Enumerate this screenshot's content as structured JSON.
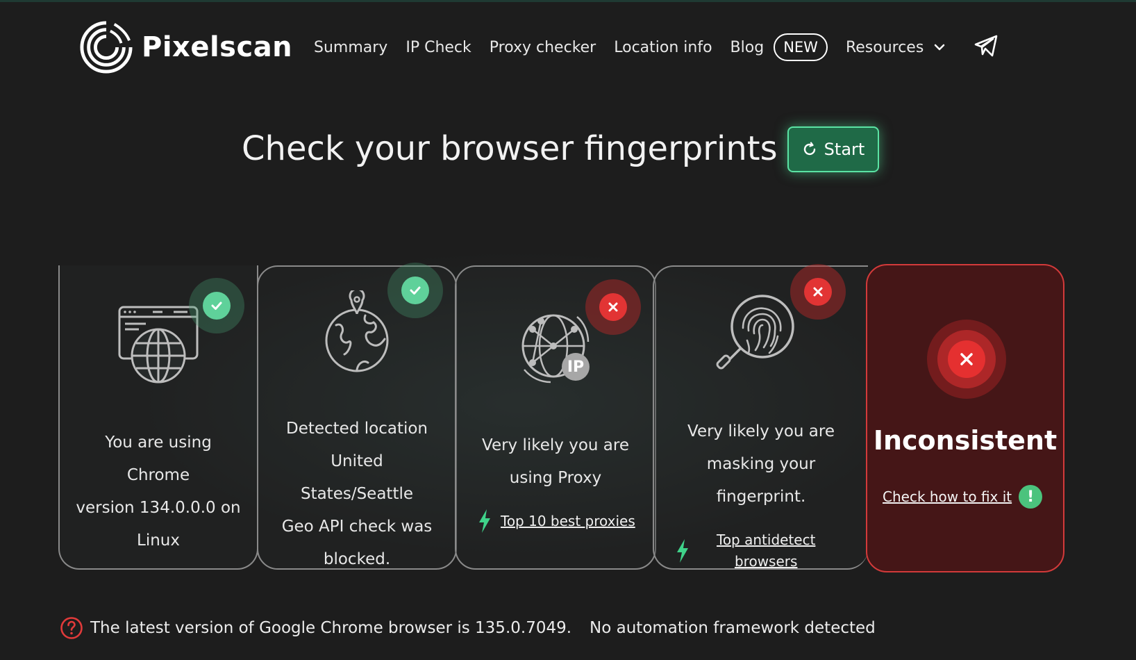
{
  "brand": {
    "name": "Pixelscan"
  },
  "nav": {
    "items": [
      {
        "label": "Summary"
      },
      {
        "label": "IP Check"
      },
      {
        "label": "Proxy checker"
      },
      {
        "label": "Location info"
      },
      {
        "label": "Blog"
      }
    ],
    "new_badge": "NEW",
    "resources_label": "Resources"
  },
  "hero": {
    "title": "Check your browser fingerprints",
    "start_label": "Start"
  },
  "cards": [
    {
      "status": "ok",
      "icon": "browser-globe-icon",
      "lines": [
        "You are using",
        "Chrome",
        "version 134.0.0.0 on",
        "Linux"
      ]
    },
    {
      "status": "ok",
      "icon": "earth-location-icon",
      "lines": [
        "Detected location",
        "United",
        "States/Seattle",
        "Geo API check was",
        "blocked."
      ]
    },
    {
      "status": "bad",
      "icon": "ip-network-icon",
      "icon_label": "IP",
      "lines": [
        "Very likely you are",
        "using Proxy"
      ],
      "link": "Top 10 best proxies"
    },
    {
      "status": "bad",
      "icon": "fingerprint-search-icon",
      "lines": [
        "Very likely you are",
        "masking your",
        "fingerprint."
      ],
      "link_lines": [
        "Top antidetect",
        "browsers"
      ]
    }
  ],
  "summary_card": {
    "status": "bad",
    "title": "Inconsistent",
    "fix_link": "Check how to fix it",
    "fix_badge": "!"
  },
  "footer": {
    "version_note": "The latest version of Google Chrome browser is 135.0.7049.",
    "automation_note": "No automation framework detected"
  },
  "colors": {
    "accent_green": "#5fd19a",
    "error_red": "#e23434",
    "background": "#1d1d1d"
  }
}
